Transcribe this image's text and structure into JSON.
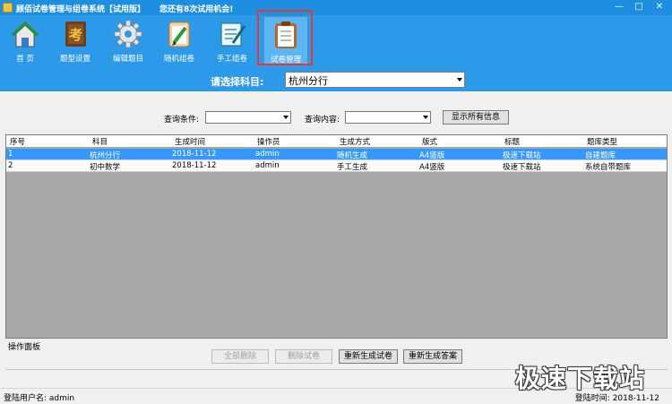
{
  "window": {
    "title": "顾佰试卷管理与组卷系统【试用版】",
    "notice": "您还有8次试用机会!",
    "controls": {
      "minimize": "—",
      "maximize": "□",
      "close": "✕"
    }
  },
  "toolbar": {
    "items": [
      {
        "label": "首 页",
        "icon": "home-icon"
      },
      {
        "label": "题型设置",
        "icon": "exam-book-icon"
      },
      {
        "label": "编辑题目",
        "icon": "gear-icon"
      },
      {
        "label": "随机组卷",
        "icon": "pencil-paper-icon"
      },
      {
        "label": "手工组卷",
        "icon": "notepad-edit-icon"
      },
      {
        "label": "试卷管理",
        "icon": "clipboard-icon"
      }
    ],
    "active": "试卷管理"
  },
  "subject": {
    "label": "请选择科目:",
    "value": "杭州分行"
  },
  "query": {
    "condition_label": "查询条件:",
    "condition_value": "",
    "content_label": "查询内容:",
    "content_value": "",
    "show_all_label": "显示所有信息"
  },
  "grid": {
    "columns": [
      "序号",
      "科目",
      "生成时间",
      "操作员",
      "生成方式",
      "版式",
      "标题",
      "题库类型"
    ],
    "rows": [
      {
        "id": "1",
        "subject": "杭州分行",
        "date": "2018-11-12",
        "operator": "admin",
        "method": "随机生成",
        "format": "A4竖版",
        "title": "极速下载站",
        "bank_type": "自建题库",
        "selected": true
      },
      {
        "id": "2",
        "subject": "初中数学",
        "date": "2018-11-12",
        "operator": "admin",
        "method": "手工生成",
        "format": "A4竖版",
        "title": "极速下载站",
        "bank_type": "系统自带题库",
        "selected": false
      }
    ]
  },
  "panel": {
    "label": "操作面板",
    "buttons": {
      "delete_all": "全部删除",
      "delete_exam": "删除试卷",
      "regenerate_exam": "重新生成试卷",
      "regenerate_answer": "重新生成答案"
    }
  },
  "status": {
    "user_label": "登陆用户名:",
    "user": "admin",
    "time_label": "登陆时间:",
    "time": "2018-11-12"
  },
  "watermark": "极速下载站",
  "colors": {
    "titlebar": "#1e8fe0",
    "toolbar": "#2d9ae9",
    "selection": "#3399ff",
    "active_frame": "#e23a3a"
  }
}
